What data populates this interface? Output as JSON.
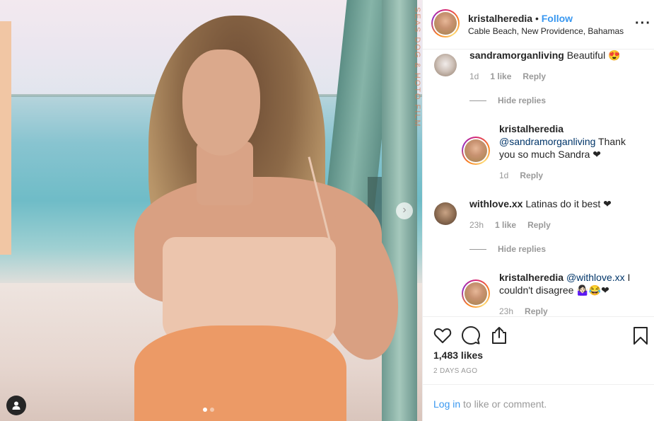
{
  "header": {
    "username": "kristalheredia",
    "separator": "•",
    "follow_label": "Follow",
    "location": "Cable Beach, New Providence, Bahamas"
  },
  "photo": {
    "overlay_text": "SEAS DOG & HOTO FILM",
    "carousel_total": 2,
    "carousel_active": 1
  },
  "comments": [
    {
      "username": "sandramorganliving",
      "text": "Beautiful 😍",
      "time": "1d",
      "likes": "1 like",
      "reply": "Reply",
      "hide_replies": "Hide replies",
      "replies": [
        {
          "username": "kristalheredia",
          "mention": "@sandramorganliving",
          "text": " Thank you so much Sandra ❤",
          "time": "1d",
          "reply": "Reply"
        }
      ]
    },
    {
      "username": "withlove.xx",
      "text": "Latinas do it best ❤",
      "time": "23h",
      "likes": "1 like",
      "reply": "Reply",
      "hide_replies": "Hide replies",
      "replies": [
        {
          "username": "kristalheredia",
          "mention": "@withlove.xx",
          "text": " I couldn't disagree 🤷🏻‍♀️😂❤",
          "time": "23h",
          "reply": "Reply"
        }
      ]
    }
  ],
  "actions": {
    "likes": "1,483 likes",
    "date": "2 DAYS AGO"
  },
  "login": {
    "link": "Log in",
    "rest": " to like or comment."
  },
  "icons": [
    "heart-icon",
    "comment-icon",
    "share-icon",
    "bookmark-icon",
    "more-icon",
    "user-tag-icon",
    "chevron-right-icon"
  ]
}
